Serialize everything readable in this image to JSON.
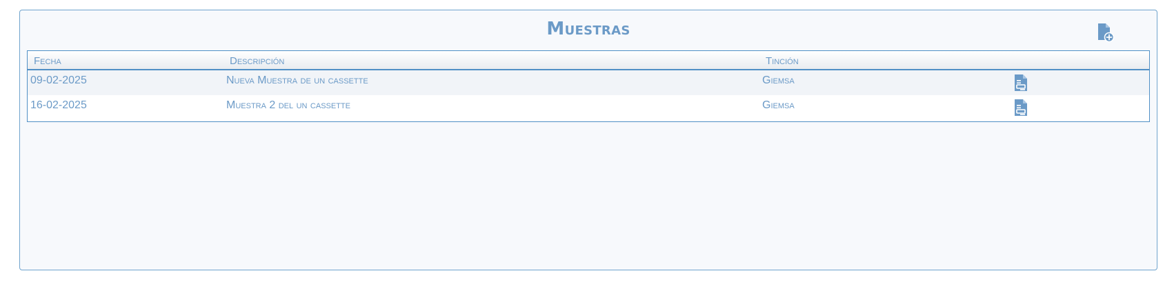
{
  "panel": {
    "title": "Muestras",
    "add_icon": "file-add-icon"
  },
  "table": {
    "headers": [
      "Fecha",
      "Descripción",
      "Tinción"
    ],
    "rows": [
      {
        "fecha": "09-02-2025",
        "descripcion": "Nueva Muestra de un cassette",
        "tincion": "Giemsa",
        "icon": "document-report-icon"
      },
      {
        "fecha": "16-02-2025",
        "descripcion": "Muestra 2 del un cassette",
        "tincion": "Giemsa",
        "icon": "document-report-icon"
      }
    ]
  },
  "colors": {
    "accent": "#6b9ac7",
    "border": "#4f8fc5",
    "row_alt": "#f1f4f8"
  }
}
